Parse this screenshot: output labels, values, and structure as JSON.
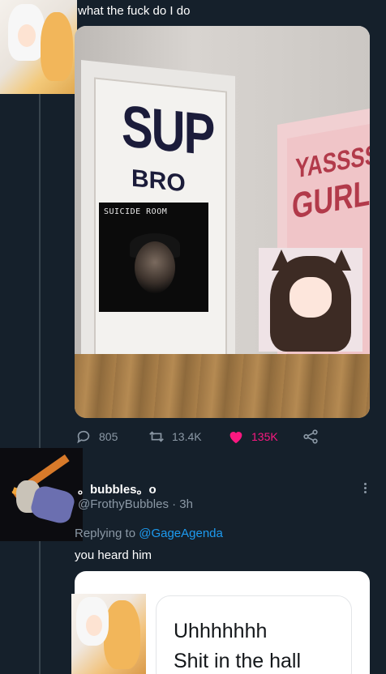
{
  "tweet": {
    "text": "what the fuck do I do",
    "image": {
      "door_left": {
        "line1": "SUP",
        "line2": "BRO"
      },
      "door_right": {
        "line1": "YASSSS",
        "line2": "GURL"
      },
      "overlay_caption": "SUICIDE ROOM"
    },
    "actions": {
      "replies": "805",
      "retweets": "13.4K",
      "likes": "135K"
    },
    "colors": {
      "like": "#f91880",
      "link": "#1d9bf0",
      "muted": "#8b98a5",
      "background": "#15202b"
    }
  },
  "reply": {
    "name": "。bubbles。o",
    "handle": "@FrothyBubbles · 3h",
    "replying_prefix": "Replying to",
    "replying_to": "@GageAgenda",
    "text": "you heard him",
    "media": {
      "line1": "Uhhhhhhh",
      "line2": "Shit in the hall"
    }
  }
}
